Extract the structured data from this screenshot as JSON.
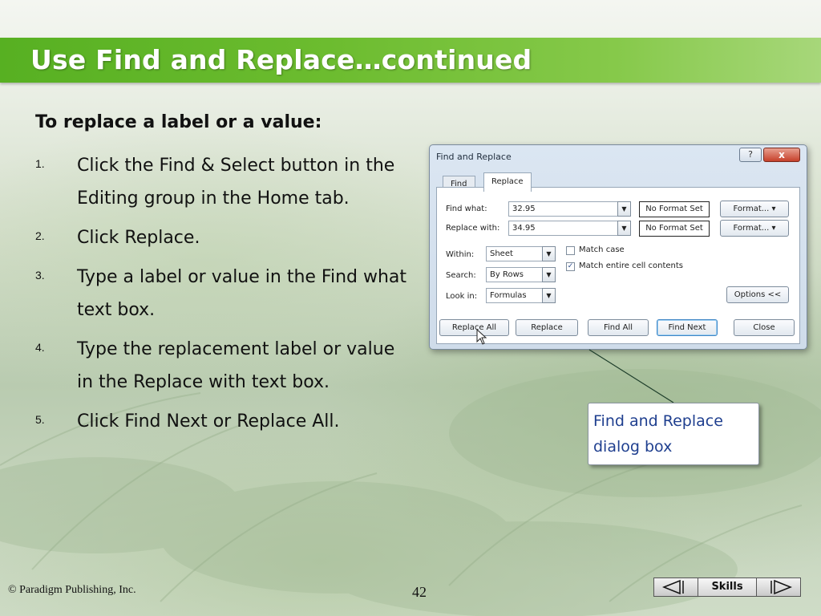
{
  "slide": {
    "title": "Use Find and Replace…continued",
    "heading": "To replace a label or a value:",
    "steps": [
      {
        "num": "1.",
        "text": "Click the Find & Select button in the Editing group in the Home tab."
      },
      {
        "num": "2.",
        "text": "Click Replace."
      },
      {
        "num": "3.",
        "text": "Type a label or value in the Find what text box."
      },
      {
        "num": "4.",
        "text": "Type the replacement label or value in the Replace with text box."
      },
      {
        "num": "5.",
        "text": "Click Find Next or Replace All."
      }
    ],
    "callout": "Find and Replace dialog box"
  },
  "dialog": {
    "title": "Find and Replace",
    "help": "?",
    "close": "x",
    "tabs": [
      {
        "label": "Find"
      },
      {
        "label": "Replace"
      }
    ],
    "find_what_label": "Find what:",
    "find_what_value": "32.95",
    "replace_with_label": "Replace with:",
    "replace_with_value": "34.95",
    "no_format": "No Format Set",
    "format_button": "Format...",
    "within_label": "Within:",
    "within_value": "Sheet",
    "search_label": "Search:",
    "search_value": "By Rows",
    "look_in_label": "Look in:",
    "look_in_value": "Formulas",
    "match_case": "Match case",
    "match_entire": "Match entire cell contents",
    "options_button": "Options <<",
    "buttons": {
      "replace_all": "Replace All",
      "replace": "Replace",
      "find_all": "Find All",
      "find_next": "Find Next",
      "close": "Close"
    }
  },
  "footer": {
    "copyright": "© Paradigm Publishing, Inc.",
    "page_number": "42",
    "nav_label": "Skills"
  },
  "colors": {
    "title_bar": "#5bb225",
    "callout_text": "#1f3f8f",
    "dialog_bg": "#d6e2ee"
  }
}
